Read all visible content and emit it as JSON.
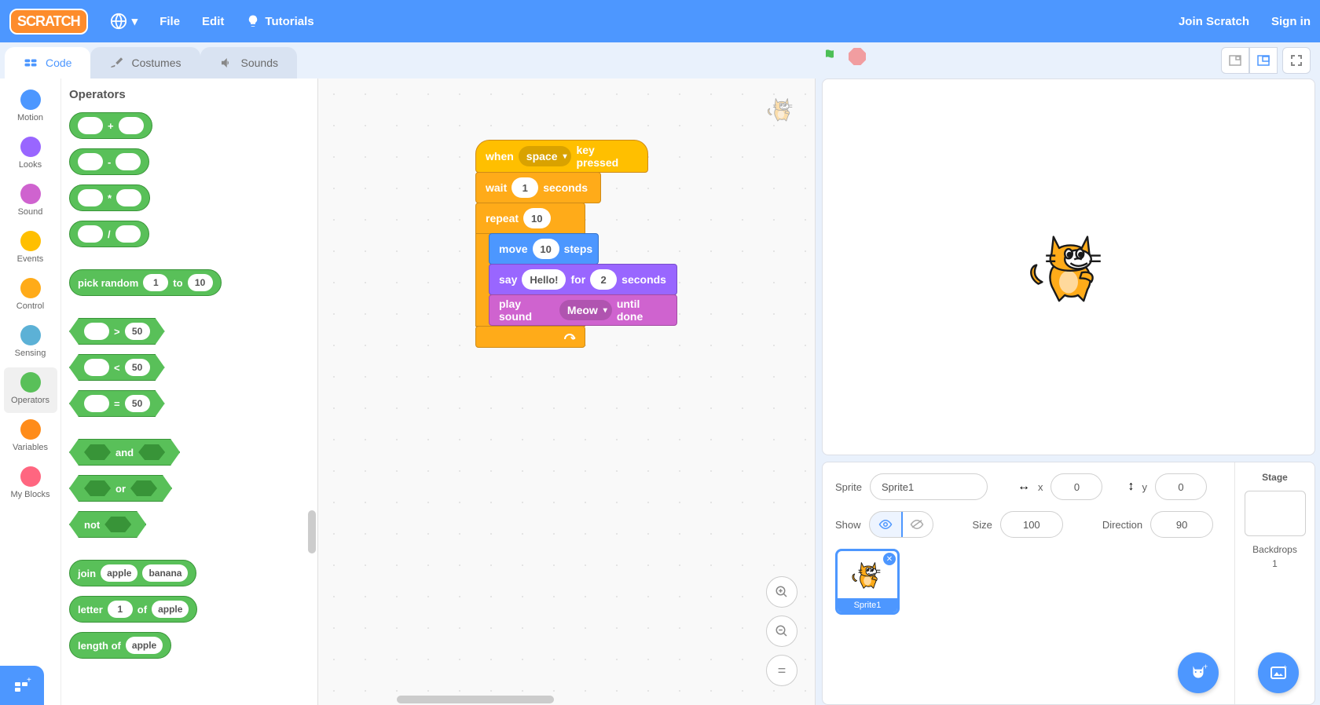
{
  "topbar": {
    "logo": "SCRATCH",
    "items": {
      "file": "File",
      "edit": "Edit",
      "tutorials": "Tutorials"
    },
    "right": {
      "join": "Join Scratch",
      "signin": "Sign in"
    }
  },
  "tabs": {
    "code": "Code",
    "costumes": "Costumes",
    "sounds": "Sounds"
  },
  "categories": [
    {
      "name": "Motion",
      "color": "#4c97ff"
    },
    {
      "name": "Looks",
      "color": "#9966ff"
    },
    {
      "name": "Sound",
      "color": "#cf63cf"
    },
    {
      "name": "Events",
      "color": "#ffbf00"
    },
    {
      "name": "Control",
      "color": "#ffab19"
    },
    {
      "name": "Sensing",
      "color": "#5cb1d6"
    },
    {
      "name": "Operators",
      "color": "#59c059"
    },
    {
      "name": "Variables",
      "color": "#ff8c1a"
    },
    {
      "name": "My Blocks",
      "color": "#ff6680"
    }
  ],
  "palette": {
    "heading": "Operators",
    "ops_sym": {
      "plus": "+",
      "minus": "-",
      "times": "*",
      "div": "/"
    },
    "pick": {
      "label1": "pick random",
      "v1": "1",
      "to": "to",
      "v2": "10"
    },
    "cmp": {
      "gt": ">",
      "lt": "<",
      "eq": "=",
      "v": "50"
    },
    "logic": {
      "and": "and",
      "or": "or",
      "not": "not"
    },
    "join": {
      "label": "join",
      "a": "apple",
      "b": "banana"
    },
    "letter": {
      "label1": "letter",
      "v": "1",
      "of": "of",
      "s": "apple"
    },
    "length": {
      "label": "length of",
      "s": "apple"
    }
  },
  "script": {
    "when1": "when",
    "space": "space",
    "when2": "key pressed",
    "wait": "wait",
    "wait_v": "1",
    "seconds": "seconds",
    "repeat": "repeat",
    "repeat_v": "10",
    "move": "move",
    "move_v": "10",
    "steps": "steps",
    "say": "say",
    "hello": "Hello!",
    "for": "for",
    "say_v": "2",
    "secs": "seconds",
    "play": "play sound",
    "meow": "Meow",
    "until": "until done"
  },
  "sprite": {
    "label": "Sprite",
    "name": "Sprite1",
    "xlabel": "x",
    "x": "0",
    "ylabel": "y",
    "y": "0",
    "show": "Show",
    "size_label": "Size",
    "size": "100",
    "dir_label": "Direction",
    "dir": "90",
    "tile": "Sprite1"
  },
  "stage_panel": {
    "title": "Stage",
    "backdrops": "Backdrops",
    "count": "1"
  }
}
